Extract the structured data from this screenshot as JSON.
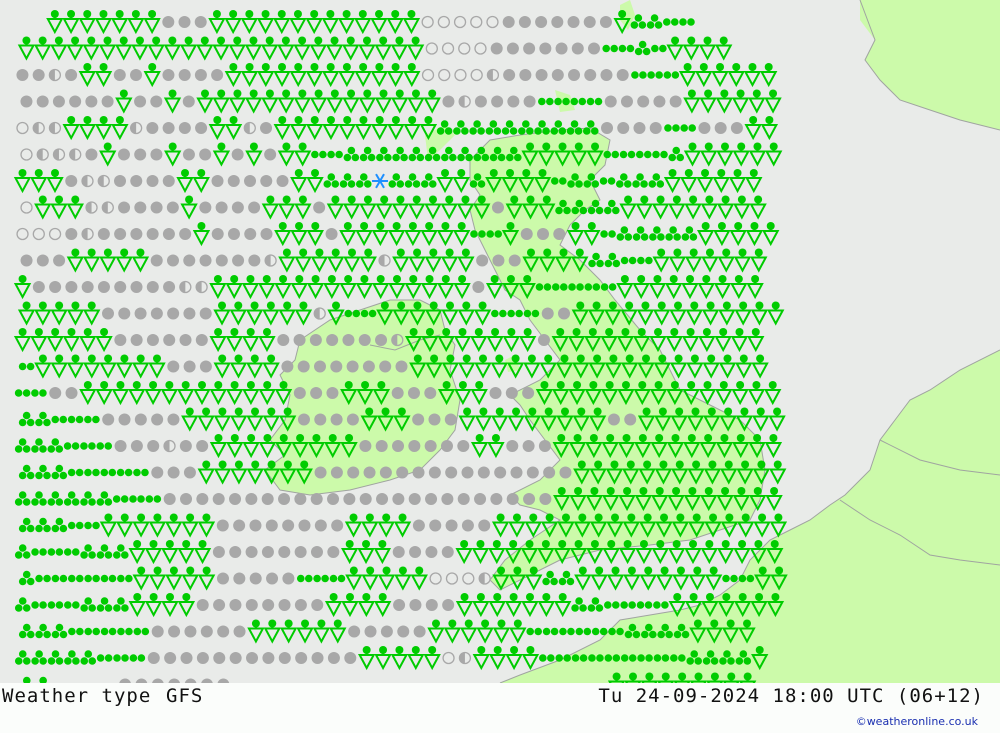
{
  "title": "Weather type",
  "model": "GFS",
  "valid_time": "Tu 24-09-2024 18:00 UTC (06+12)",
  "credit": "©weatheronline.co.uk",
  "colors": {
    "sea": "#e9ebe9",
    "land": "#ccfaaa",
    "border": "#a0a4a0",
    "precip": "#00cc00",
    "cloud": "#a8a8a8",
    "snow": "#1e90ff"
  },
  "legend_codes": {
    "S": "rain-shower",
    "O": "overcast",
    "C": "clear",
    "P": "partly-cloudy",
    "R": "rain",
    "H": "heavy-rain",
    "N": "snow"
  },
  "symbol_rows": [
    "....SSSSSSSOOOSSSSSSSSSSSSSCCCCCOOOOOOOSHHRR",
    "..SSSSSSSSSSSSSSSSSSSSSSSSSCCCCOOOOOOORRHRSSSS",
    "..OOPOSSOOSOOOOSSSSSSSSSSSSCCCCPOOOOOOOORRRSSSSSS",
    "..OOOOOOSOOSOSSSSSSSSSSSSSSSOPOOOORRRROOOOOSSSSSS",
    "..CPPSSSSPOOOOSSPOSSSSSSSSSSHHHHHHHHHHOOOORROOOSS",
    "..CPPPOSOOOSOOSOSOSSRRHHHHHHHHHHHSSSSSRRRRHSSSSSS",
    "..SSSOPPOOOOSSOOOOOSSHHHNHHHSSHSSSSRHHRHHHSSSSSS",
    "..CSSSPPOOOOSOOOOSSSOSSSSSSSSSSOSSSHHHHSSSSSSSSS",
    "..CCCOPOOOOOOSOOOOSSSOSSSSSSSSRRSOOOSSRHHHHHSSSSS",
    "..OOOSSSSSOOOOOOOPSSSSSSPSSSSSOOOSSSSHHRRSSSSSSS",
    "..SOOOOOOOOOPPSSSSSSSSSSSSSSSSOSSSRRRRRSSSSSSSSS",
    "..SSSSSOOOOOOOSSSSSSPSRRSSSSSSSRRROOSSSSSSSSSSSSS",
    "..SSSSSSOOOOOOSSSSOOOOOOOPSSSSSSSSOSSSSSSSSSSSSS",
    "..RSSSSSSSSOOOSSSSOOOOOOOOSSSSSSSSSSSSSSSSSSSSSS",
    "..RROOSSSSSSSSSSSSSOOOSSSOOOSSSOOOSSSSSSSSSSSSSSS",
    "..HHRRROOOOOSSSSSSSOOOOSSSOOOSSSSSSSSSOOSSSSSSSSS",
    "..HHHRRROOOPOOSSSSSSSSSOOOOOOOSSOOOSSSSSSSSSSSSSS",
    "..HHHRRRRROOOSSSSSSSOOOOOOOOOOOOOOOOSSSSSSSSSSSSS",
    "..HHHHHHRRROOOOOOOOOOOOOOOOOOOOOOOOSSSSSSSSSSSSSS",
    "..HHHRRSSSSSSSOOOOOOOOSSSSOOOOOSSSSSSSSSSSSSSSSSS",
    "..HRRRHHHSSSSSOOOOOOOOSSSOOOOSSSSSSSSSSSSSSSSSSSS",
    "..HRRRRRRSSSSSOOOOORRRSSSSSCCCPSSSHHSSSSSSSSSRRSS",
    "..HRRRHHHSSSSOOOOOOOOSSSSOOOOSSSSSSSHHRRRRSSSSSSS",
    "..HHHRRRRROOOOOOSSSSSSOOOOOSSSSSSRRRRRRHHHHSSSS",
    "..HHHHHRRROOOOOOOOOOOOOSSSSSCPSSSSRRRRRRRRRHHHHS",
    "..HH....OOOOOOO.......................SSSSSSSSS"
  ]
}
